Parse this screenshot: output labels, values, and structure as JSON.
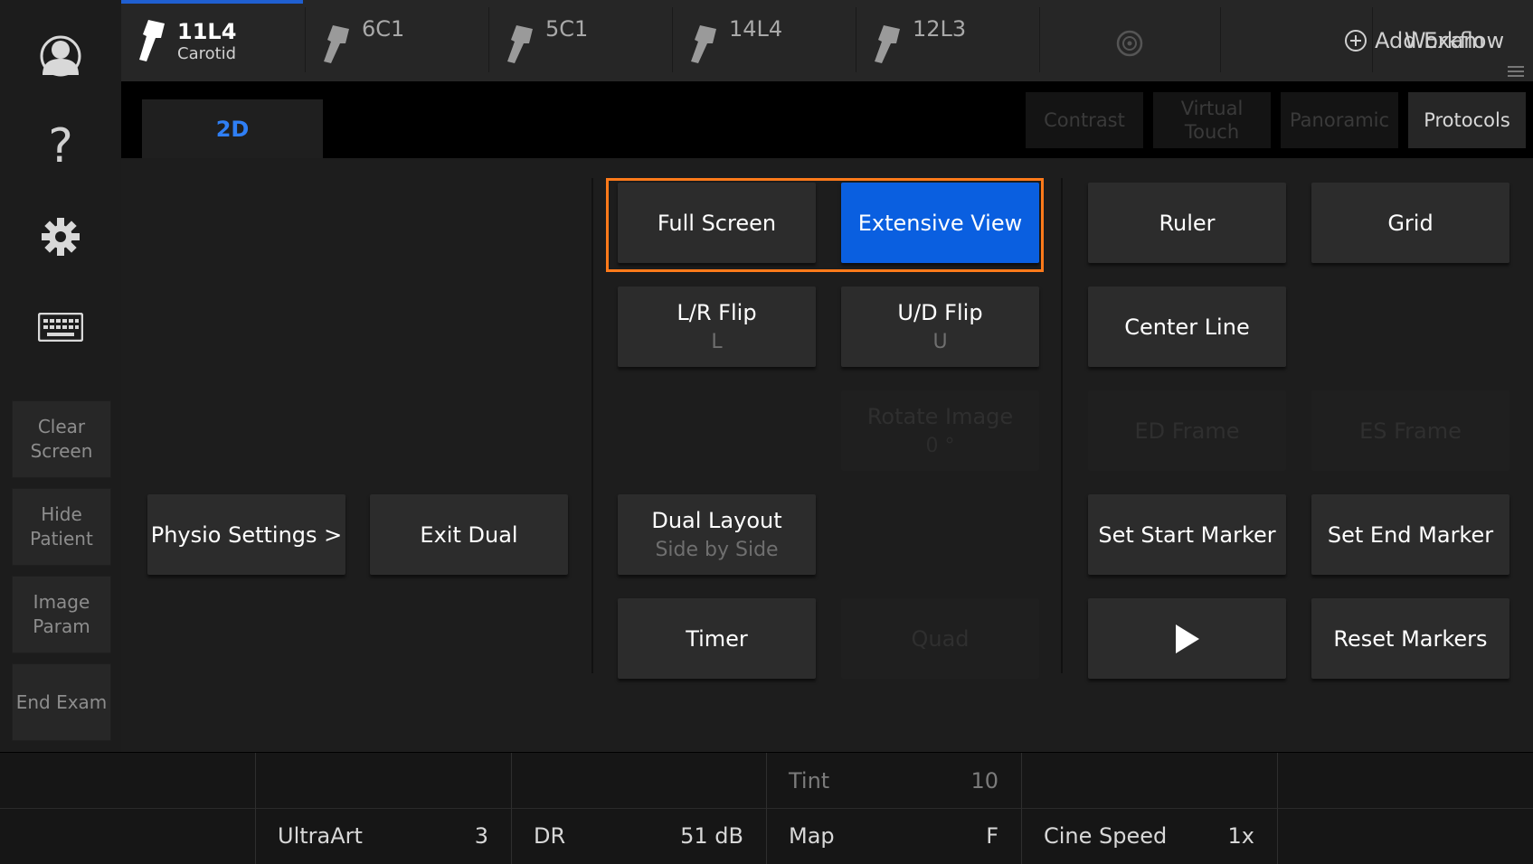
{
  "sidebar": {
    "icons": [
      "user-icon",
      "help-icon",
      "gear-icon",
      "keyboard-icon"
    ],
    "help_glyph": "?",
    "buttons": [
      {
        "label": "Clear\nScreen"
      },
      {
        "label": "Hide\nPatient"
      },
      {
        "label": "Image\nParam"
      },
      {
        "label": "End Exam"
      }
    ]
  },
  "topbar": {
    "probes": [
      {
        "name": "11L4",
        "sub": "Carotid",
        "active": true
      },
      {
        "name": "6C1",
        "sub": ""
      },
      {
        "name": "5C1",
        "sub": ""
      },
      {
        "name": "14L4",
        "sub": ""
      },
      {
        "name": "12L3",
        "sub": ""
      }
    ],
    "add_exam": "Add Exam",
    "workflow": "Workflow"
  },
  "modes": {
    "active_tab": "2D",
    "buttons": [
      {
        "label": "Contrast",
        "enabled": false
      },
      {
        "label": "Virtual\nTouch",
        "enabled": false
      },
      {
        "label": "Panoramic",
        "enabled": false
      },
      {
        "label": "Protocols",
        "enabled": true
      }
    ]
  },
  "main": {
    "physio_settings": "Physio Settings >",
    "exit_dual": "Exit Dual",
    "full_screen": "Full Screen",
    "extensive_view": "Extensive View",
    "lr_flip": {
      "label": "L/R Flip",
      "sub": "L"
    },
    "ud_flip": {
      "label": "U/D Flip",
      "sub": "U"
    },
    "rotate_image": {
      "label": "Rotate Image",
      "sub": "0 °"
    },
    "dual_layout": {
      "label": "Dual Layout",
      "sub": "Side by Side"
    },
    "timer": "Timer",
    "quad": "Quad",
    "ruler": "Ruler",
    "grid": "Grid",
    "center_line": "Center Line",
    "ed_frame": "ED Frame",
    "es_frame": "ES Frame",
    "set_start_marker": "Set Start Marker",
    "set_end_marker": "Set End Marker",
    "reset_markers": "Reset Markers"
  },
  "params": {
    "tint": {
      "label": "Tint",
      "value": "10"
    },
    "ultraart": {
      "label": "UltraArt",
      "value": "3"
    },
    "dr": {
      "label": "DR",
      "value": "51 dB"
    },
    "map": {
      "label": "Map",
      "value": "F"
    },
    "cine_speed": {
      "label": "Cine Speed",
      "value": "1x"
    }
  },
  "colors": {
    "accent_blue": "#0a5fe0",
    "tab_blue": "#2f7ff5",
    "highlight_orange": "#ff7a1a"
  }
}
